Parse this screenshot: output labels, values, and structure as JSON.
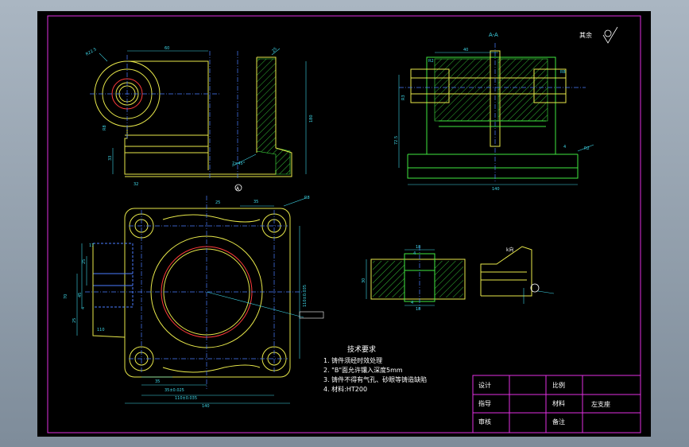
{
  "drawing": {
    "section_label": "A-A",
    "roughness_note": "其余",
    "view_marker": "A",
    "view_k_label": "k向"
  },
  "dimensions": {
    "top_view": [
      "60",
      "R22.5",
      "R8",
      "33",
      "180",
      "32",
      "2×45°",
      "25"
    ],
    "plan_view": [
      "25",
      "R8",
      "35",
      "17",
      "25",
      "70",
      "45",
      "4",
      "25",
      "35",
      "110",
      "140",
      "35±0.025",
      "110±0.035",
      "110±0.035"
    ],
    "section_view": [
      "40",
      "R2",
      "R8",
      "72.5",
      "140",
      "4",
      "R2",
      "R3"
    ],
    "detail_view": [
      "18",
      "4",
      "30",
      "4",
      "18"
    ]
  },
  "tech_requirements": {
    "title": "技术要求",
    "items": [
      "1. 铸件须经时效处理",
      "2. \"B\"面允许镶入深度5mm",
      "3. 铸件不得有气孔、砂眼等铸造缺陷",
      "4. 材料:HT200"
    ]
  },
  "title_block": {
    "design": "设计",
    "guide": "指导",
    "review": "审核",
    "scale": "比例",
    "material": "材料",
    "remark": "备注",
    "part_name": "左支座"
  },
  "colors": {
    "background": "#000000",
    "frame": "#e22fe2",
    "outline": "#e8e84a",
    "dimension": "#3fd7e8",
    "center": "#4a7dff",
    "section": "#41e841"
  }
}
